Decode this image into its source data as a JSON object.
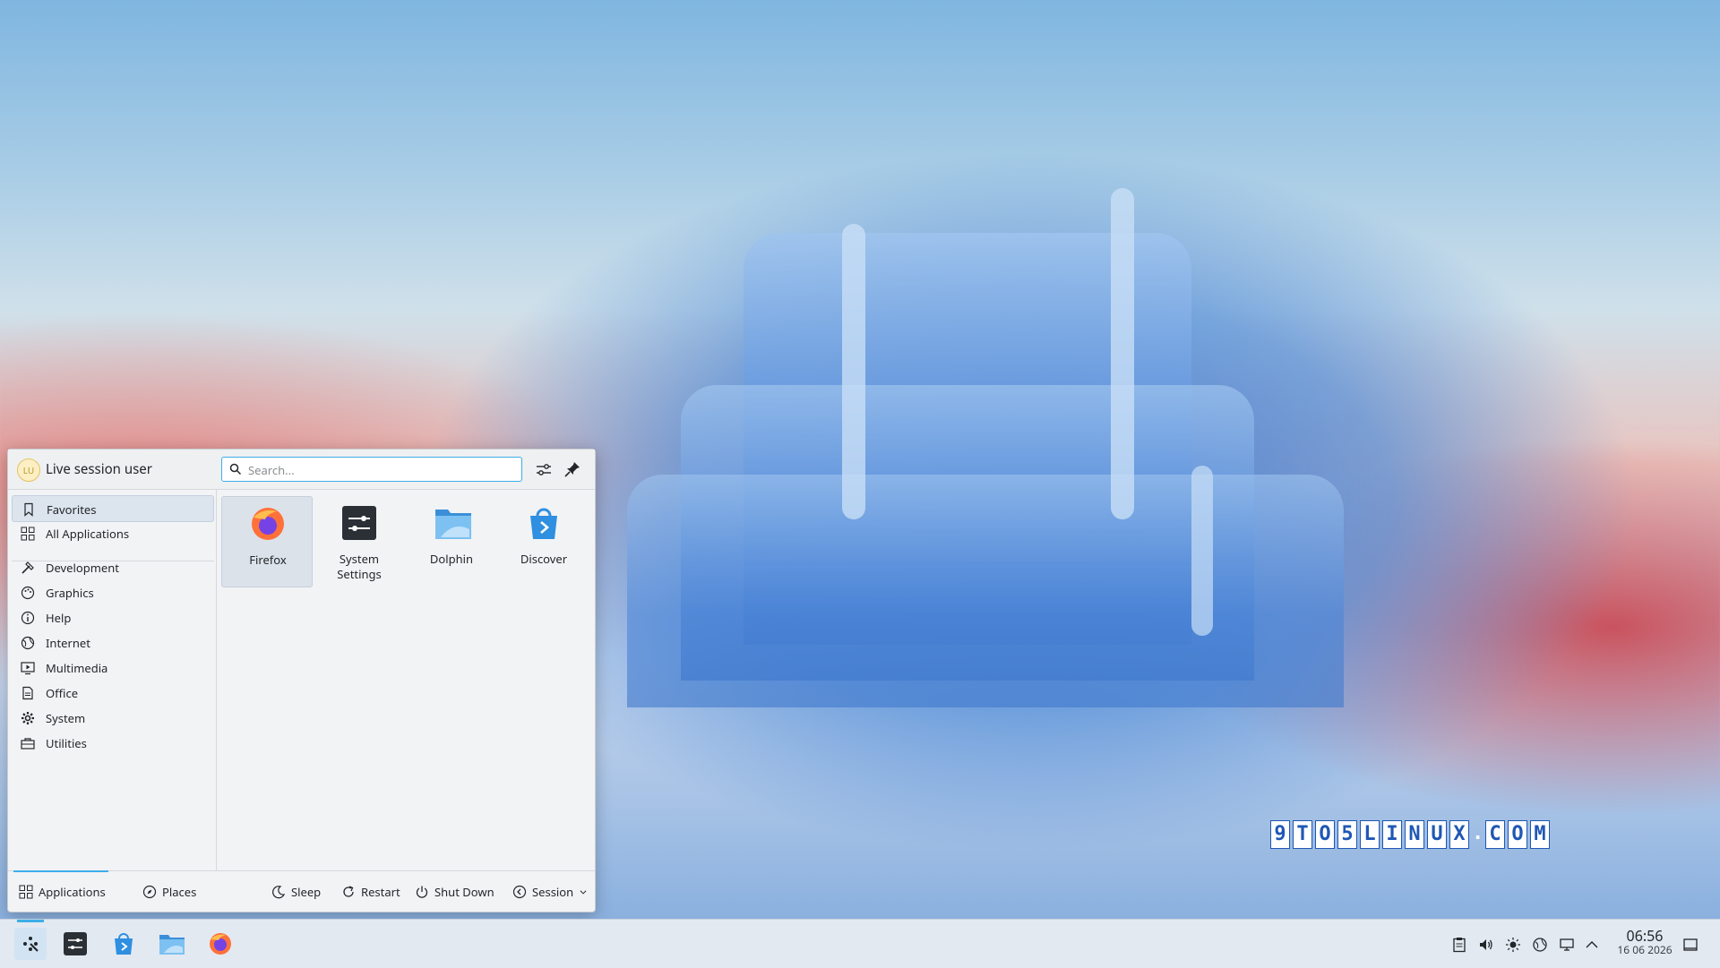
{
  "launcher": {
    "user_name": "Live session user",
    "avatar_initials": "LU",
    "search_placeholder": "Search...",
    "sidebar": [
      {
        "label": "Favorites",
        "icon": "bookmark-icon",
        "selected": true
      },
      {
        "label": "All Applications",
        "icon": "grid-icon",
        "selected": false
      },
      {
        "label": "Development",
        "icon": "hammer-icon",
        "selected": false
      },
      {
        "label": "Graphics",
        "icon": "palette-icon",
        "selected": false
      },
      {
        "label": "Help",
        "icon": "info-icon",
        "selected": false
      },
      {
        "label": "Internet",
        "icon": "globe-icon",
        "selected": false
      },
      {
        "label": "Multimedia",
        "icon": "monitor-play-icon",
        "selected": false
      },
      {
        "label": "Office",
        "icon": "document-icon",
        "selected": false
      },
      {
        "label": "System",
        "icon": "gear-icon",
        "selected": false
      },
      {
        "label": "Utilities",
        "icon": "toolbox-icon",
        "selected": false
      }
    ],
    "favorites": [
      {
        "label": "Firefox",
        "icon": "firefox-icon",
        "selected": true
      },
      {
        "label": "System\nSettings",
        "icon": "system-settings-icon",
        "selected": false
      },
      {
        "label": "Dolphin",
        "icon": "folder-icon",
        "selected": false
      },
      {
        "label": "Discover",
        "icon": "discover-bag-icon",
        "selected": false
      }
    ],
    "footer": {
      "tab_applications": "Applications",
      "tab_places": "Places",
      "sleep": "Sleep",
      "restart": "Restart",
      "shutdown": "Shut Down",
      "session": "Session"
    }
  },
  "watermark": [
    "9",
    "T",
    "O",
    "5",
    "L",
    "I",
    "N",
    "U",
    "X",
    ".",
    "C",
    "O",
    "M"
  ],
  "taskbar": {
    "apps": [
      "kde-launcher-icon",
      "system-settings-icon",
      "discover-bag-icon",
      "dolphin-folder-icon",
      "firefox-icon"
    ],
    "tray": [
      "clipboard-icon",
      "volume-icon",
      "brightness-icon",
      "network-icon",
      "display-icon",
      "chevron-up-icon"
    ],
    "clock_time": "06:56",
    "clock_date": "16 06 2026"
  },
  "colors": {
    "accent": "#3daee9",
    "panel_bg": "#f2f3f5",
    "taskbar_bg": "#e3e9f1",
    "watermark_blue": "#1f57b5"
  }
}
